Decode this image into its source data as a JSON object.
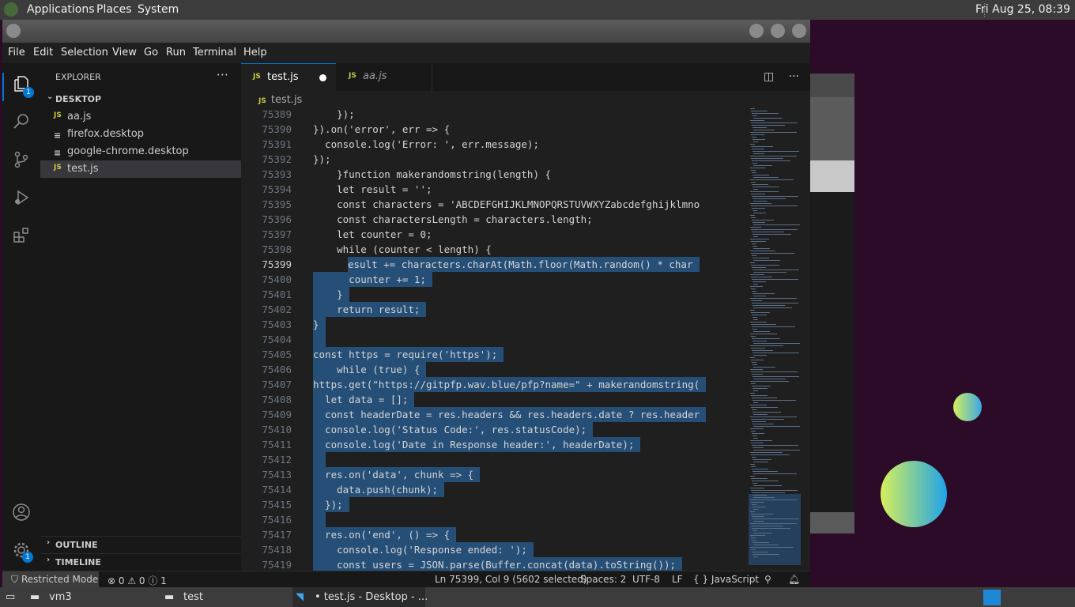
{
  "topbar": {
    "menus": [
      "Applications",
      "Places",
      "System"
    ],
    "clock": "Fri Aug 25, 08:39"
  },
  "menubar": [
    "File",
    "Edit",
    "Selection",
    "View",
    "Go",
    "Run",
    "Terminal",
    "Help"
  ],
  "activity": {
    "explorer_badge": "1",
    "manage_badge": "1"
  },
  "sidebar": {
    "header": "EXPLORER",
    "more": "···",
    "folder": "DESKTOP",
    "files": [
      {
        "icon": "JS",
        "name": "aa.js"
      },
      {
        "icon": "≡",
        "name": "firefox.desktop"
      },
      {
        "icon": "≡",
        "name": "google-chrome.desktop"
      },
      {
        "icon": "JS",
        "name": "test.js"
      }
    ],
    "outline": "OUTLINE",
    "timeline": "TIMELINE"
  },
  "tabs": [
    {
      "icon": "JS",
      "label": "test.js",
      "modified": true
    },
    {
      "icon": "JS",
      "label": "aa.js"
    }
  ],
  "breadcrumb": {
    "icon": "JS",
    "file": "test.js"
  },
  "code": [
    {
      "n": "75389",
      "t": "    });"
    },
    {
      "n": "75390",
      "t": "}).on('error', err => {"
    },
    {
      "n": "75391",
      "t": "  console.log('Error: ', err.message);"
    },
    {
      "n": "75392",
      "t": "});"
    },
    {
      "n": "75393",
      "t": "    }function makerandomstring(length) {"
    },
    {
      "n": "75394",
      "t": "    let result = '';"
    },
    {
      "n": "75395",
      "t": "    const characters = 'ABCDEFGHIJKLMNOPQRSTUVWXYZabcdefghijklmno"
    },
    {
      "n": "75396",
      "t": "    const charactersLength = characters.length;"
    },
    {
      "n": "75397",
      "t": "    let counter = 0;"
    },
    {
      "n": "75398",
      "t": "    while (counter < length) {"
    },
    {
      "n": "75399",
      "t": "      result += characters.charAt(Math.floor(Math.random() * char"
    },
    {
      "n": "75400",
      "t": "      counter += 1;"
    },
    {
      "n": "75401",
      "t": "    }"
    },
    {
      "n": "75402",
      "t": "    return result;"
    },
    {
      "n": "75403",
      "t": "}"
    },
    {
      "n": "75404",
      "t": ""
    },
    {
      "n": "75405",
      "t": "const https = require('https');"
    },
    {
      "n": "75406",
      "t": "    while (true) {"
    },
    {
      "n": "75407",
      "t": "https.get(\"https://gitpfp.wav.blue/pfp?name=\" + makerandomstring("
    },
    {
      "n": "75408",
      "t": "  let data = [];"
    },
    {
      "n": "75409",
      "t": "  const headerDate = res.headers && res.headers.date ? res.header"
    },
    {
      "n": "75410",
      "t": "  console.log('Status Code:', res.statusCode);"
    },
    {
      "n": "75411",
      "t": "  console.log('Date in Response header:', headerDate);"
    },
    {
      "n": "75412",
      "t": ""
    },
    {
      "n": "75413",
      "t": "  res.on('data', chunk => {"
    },
    {
      "n": "75414",
      "t": "    data.push(chunk);"
    },
    {
      "n": "75415",
      "t": "  });"
    },
    {
      "n": "75416",
      "t": ""
    },
    {
      "n": "75417",
      "t": "  res.on('end', () => {"
    },
    {
      "n": "75418",
      "t": "    console.log('Response ended: ');"
    },
    {
      "n": "75419",
      "t": "    const users = JSON.parse(Buffer.concat(data).toString());"
    }
  ],
  "status": {
    "restricted": "Restricted Mode",
    "problems": "⊗ 0 ⚠ 0 ⓘ 1",
    "position": "Ln 75399, Col 9 (5602 selected)",
    "spaces": "Spaces: 2",
    "encoding": "UTF-8",
    "eol": "LF",
    "language": "{ } JavaScript"
  },
  "taskbar": [
    {
      "label": "vm3"
    },
    {
      "label": "test"
    },
    {
      "label": "• test.js - Desktop - ..."
    }
  ]
}
